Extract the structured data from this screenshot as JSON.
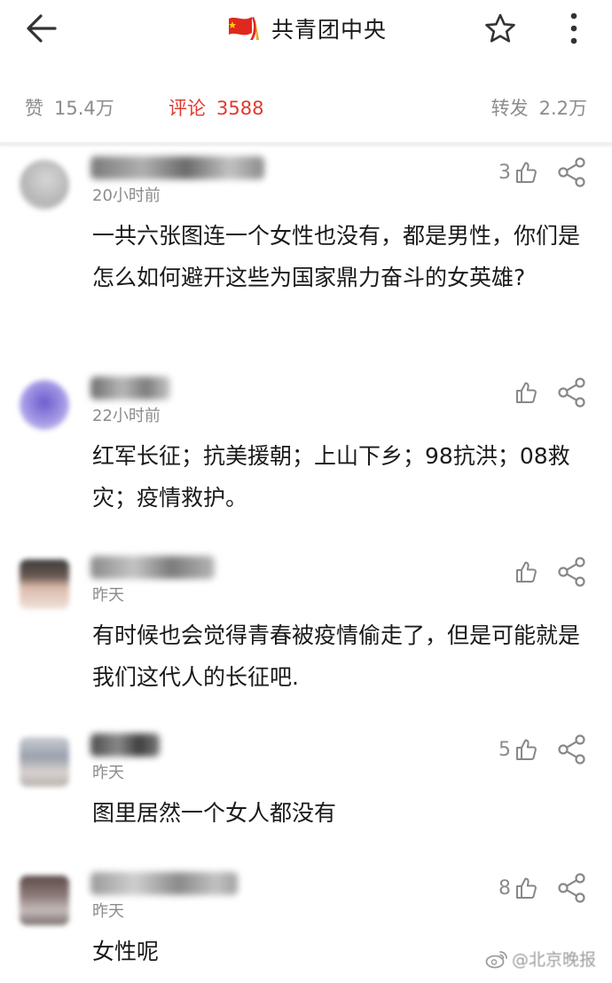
{
  "header": {
    "title": "共青团中央",
    "icons": {
      "back": "back-arrow-icon",
      "favorite": "star-icon",
      "more": "more-vertical-icon",
      "logo": "flag-logo-icon"
    }
  },
  "stats": {
    "likes": {
      "label": "赞",
      "value": "15.4万"
    },
    "comments": {
      "label": "评论",
      "value": "3588"
    },
    "shares": {
      "label": "转发",
      "value": "2.2万"
    }
  },
  "comments": [
    {
      "time": "20小时前",
      "likes": "3",
      "text": "一共六张图连一个女性也没有，都是男性，你们是怎么如何避开这些为国家鼎力奋斗的女英雄?"
    },
    {
      "time": "22小时前",
      "likes": "",
      "text": "红军长征；抗美援朝；上山下乡；98抗洪；08救灾；疫情救护。"
    },
    {
      "time": "昨天",
      "likes": "",
      "text": "有时候也会觉得青春被疫情偷走了，但是可能就是我们这代人的长征吧."
    },
    {
      "time": "昨天",
      "likes": "5",
      "text": "图里居然一个女人都没有"
    },
    {
      "time": "昨天",
      "likes": "8",
      "text": "女性呢"
    }
  ],
  "watermark": {
    "text": "@北京晚报",
    "icon": "weibo-icon"
  },
  "colors": {
    "accent": "#e03a2f",
    "muted": "#8c8c8c",
    "text": "#1a1a1a",
    "divider": "#f0f0f0"
  }
}
